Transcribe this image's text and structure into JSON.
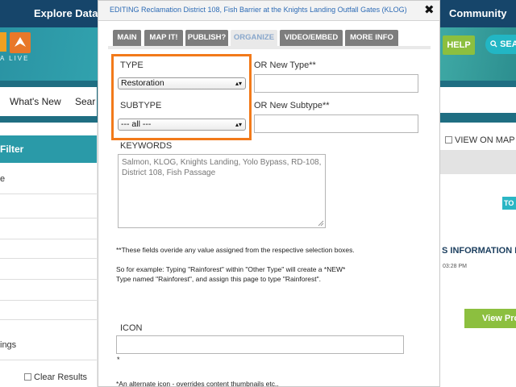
{
  "background": {
    "nav": {
      "explore": "Explore Data",
      "community": "Community"
    },
    "logo_text": "A LIVE",
    "help_label": "HELP",
    "search_label": "SEAR",
    "whats_new": "What's New",
    "search_tab": "Sear",
    "sidebar": {
      "filter": "Filter",
      "item_e": "e",
      "item_ings": "ings",
      "clear_results": "Clear Results"
    },
    "right": {
      "view_on_map": "VIEW ON MAP",
      "to_badge": "TO",
      "info_heading": "S INFORMATION I",
      "time": "03:28 PM",
      "view_button": "View Pro"
    }
  },
  "modal": {
    "title": "EDITING Reclamation District 108, Fish Barrier at the Knights Landing Outfall Gates (KLOG)",
    "tabs": [
      {
        "label": "MAIN"
      },
      {
        "label": "MAP IT!"
      },
      {
        "label": "PUBLISH?"
      },
      {
        "label": "ORGANIZE"
      },
      {
        "label": "VIDEO/EMBED"
      },
      {
        "label": "MORE INFO"
      }
    ],
    "type_label": "TYPE",
    "type_value": "Restoration",
    "or_new_type_label": "OR New Type**",
    "subtype_label": "SUBTYPE",
    "subtype_value": "--- all ---",
    "or_new_subtype_label": "OR New Subtype**",
    "keywords_label": "KEYWORDS",
    "keywords_value": "Salmon, KLOG, Knights Landing, Yolo Bypass, RD-108, District 108, Fish Passage",
    "note_line1": "**These fields overide any value assigned from the respective selection boxes.",
    "note_line2": "So for example: Typing \"Rainforest\" within \"Other Type\" will create a *NEW* Type named \"Rainforest\", and assign this page to type \"Rainforest\".",
    "icon_label": "ICON",
    "icon_star": "*",
    "icon_note": "*An alternate icon - overrides content thumbnails etc.."
  },
  "colors": {
    "highlight": "#f27a1a",
    "nav_bg": "#16456a",
    "tab_bg": "#7d7d7d",
    "active_tab_text": "#8aa8cc",
    "link_blue": "#2d6bb5"
  }
}
